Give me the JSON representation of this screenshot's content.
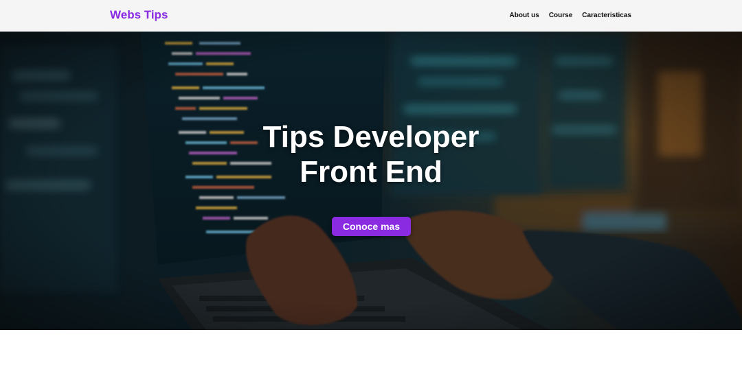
{
  "header": {
    "brand": "Webs Tips",
    "nav": [
      "About us",
      "Course",
      "Caracteristicas"
    ]
  },
  "hero": {
    "title_line1": "Tips Developer",
    "title_line2": "Front End",
    "cta_label": "Conoce mas",
    "background_icon": "developer-coding-photo"
  },
  "colors": {
    "brand": "#8a2be2",
    "nav_bg": "#f5f5f5",
    "nav_text": "#111111",
    "hero_text": "#ffffff"
  }
}
